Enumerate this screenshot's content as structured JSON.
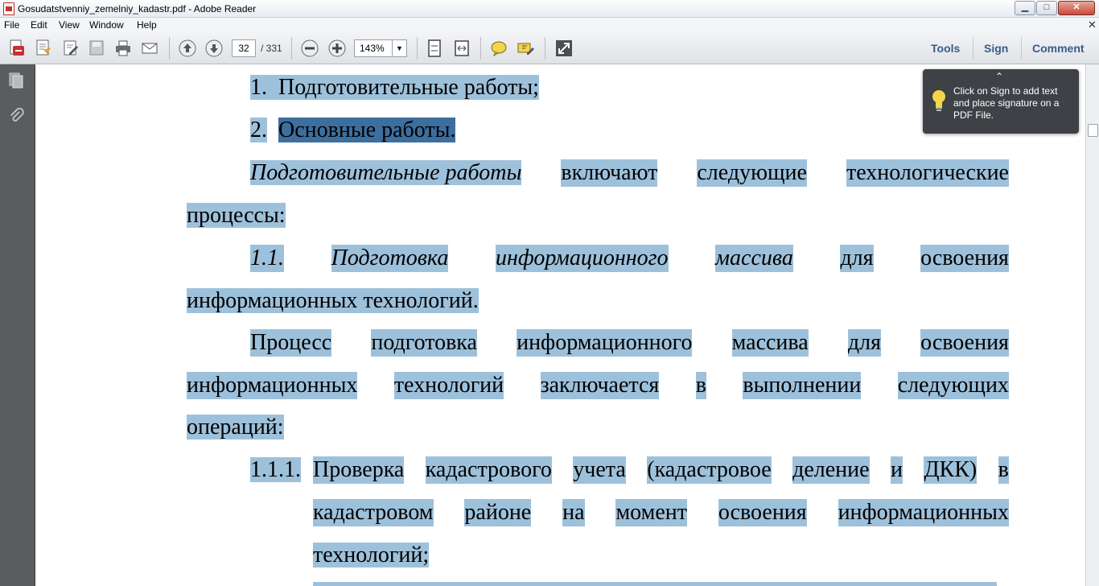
{
  "window": {
    "title": "Gosudatstvenniy_zemelniy_kadastr.pdf - Adobe Reader",
    "min_label": "▁",
    "max_label": "□",
    "close_label": "✕"
  },
  "menu": {
    "items": [
      "File",
      "Edit",
      "View",
      "Window",
      "Help"
    ],
    "close_label": "✕"
  },
  "toolbar": {
    "current_page": "32",
    "page_total": "/ 331",
    "zoom": "143%",
    "zoom_drop": "▼",
    "tools_label": "Tools",
    "sign_label": "Sign",
    "comment_label": "Comment"
  },
  "tooltip": {
    "caret": "⌃",
    "text": "Click on Sign to add text and place signature on a PDF File."
  },
  "document": {
    "l1_num": "1.",
    "l1_text": "Подготовительные работы;",
    "l2_num": "2.",
    "l2_text": "Основные работы.",
    "l3_first": "П",
    "l3_italic": "одготовительные работы",
    "l3_words": [
      "включают",
      "следующие",
      "технологические"
    ],
    "l4": "процессы:",
    "l5_words": [
      "1.1.",
      "Подготовка",
      "информационного",
      "массива",
      "для",
      "освоения"
    ],
    "l6": "информационных технологий.",
    "l7_words": [
      "Процесс",
      "подготовка",
      "информационного",
      "массива",
      "для",
      "освоения"
    ],
    "l8_words": [
      "информационных",
      "технологий",
      "заключается",
      "в",
      "выполнении",
      "следующих"
    ],
    "l9": "операций:",
    "l10_num": "1.1.1.",
    "l10_words": [
      "Проверка",
      "кадастрового",
      "учета",
      "(кадастровое",
      "деление",
      "и",
      "ДКК)",
      "в"
    ],
    "l11_words": [
      "кадастровом",
      "районе",
      "на",
      "момент",
      "освоения",
      "информационных"
    ],
    "l12": "технологий;"
  }
}
